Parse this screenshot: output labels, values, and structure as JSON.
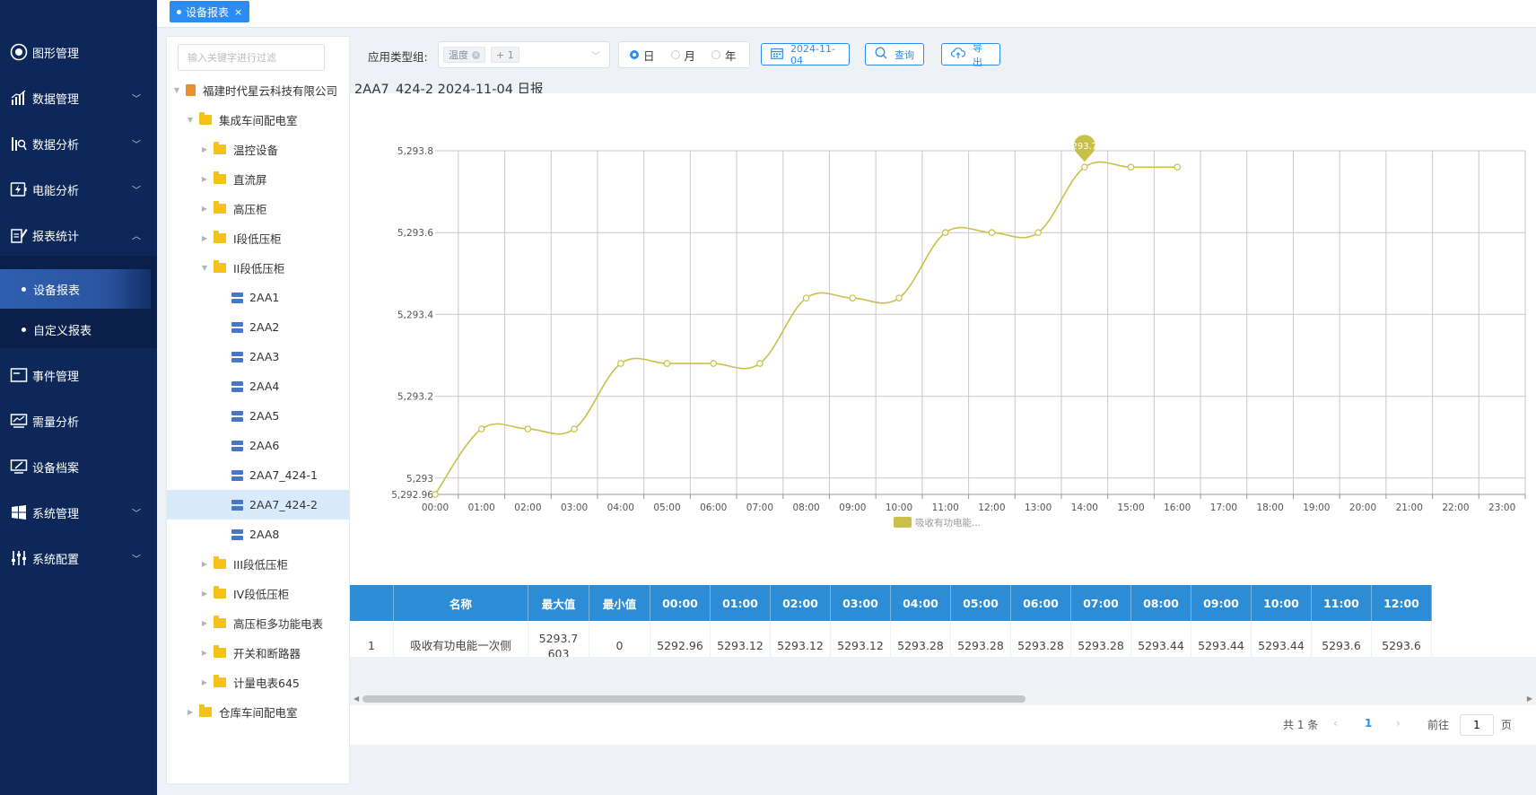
{
  "sidebar": {
    "items": [
      {
        "label": "图形管理",
        "icon": "shield-icon"
      },
      {
        "label": "数据管理",
        "icon": "bar-chart-icon"
      },
      {
        "label": "数据分析",
        "icon": "analysis-icon"
      },
      {
        "label": "电能分析",
        "icon": "lightning-icon"
      },
      {
        "label": "报表统计",
        "icon": "report-icon"
      },
      {
        "label": "事件管理",
        "icon": "event-icon"
      },
      {
        "label": "需量分析",
        "icon": "monitor-chart-icon"
      },
      {
        "label": "设备档案",
        "icon": "device-file-icon"
      },
      {
        "label": "系统管理",
        "icon": "windows-icon"
      },
      {
        "label": "系统配置",
        "icon": "sliders-icon"
      }
    ],
    "sub_items": [
      {
        "label": "设备报表"
      },
      {
        "label": "自定义报表"
      }
    ]
  },
  "tabs": [
    {
      "label": "设备报表",
      "close": "×"
    }
  ],
  "tree": {
    "filter_placeholder": "输入关键字进行过滤",
    "nodes": [
      {
        "label": "福建时代星云科技有限公司"
      },
      {
        "label": "集成车间配电室"
      },
      {
        "label": "温控设备"
      },
      {
        "label": "直流屏"
      },
      {
        "label": "高压柜"
      },
      {
        "label": "I段低压柜"
      },
      {
        "label": "II段低压柜"
      },
      {
        "label": "2AA1"
      },
      {
        "label": "2AA2"
      },
      {
        "label": "2AA3"
      },
      {
        "label": "2AA4"
      },
      {
        "label": "2AA5"
      },
      {
        "label": "2AA6"
      },
      {
        "label": "2AA7_424-1"
      },
      {
        "label": "2AA7_424-2"
      },
      {
        "label": "2AA8"
      },
      {
        "label": "III段低压柜"
      },
      {
        "label": "IV段低压柜"
      },
      {
        "label": "高压柜多功能电表"
      },
      {
        "label": "开关和断路器"
      },
      {
        "label": "计量电表645"
      },
      {
        "label": "仓库车间配电室"
      }
    ]
  },
  "toolbar": {
    "type_label": "应用类型组:",
    "tag_value": "温度",
    "tag_close": "×",
    "tag_more": "+ 1",
    "periods": [
      "日",
      "月",
      "年"
    ],
    "selected_period": "日",
    "date": "2024-11-04",
    "query_label": "查询",
    "export_label": "导出"
  },
  "report_title": "2AA7_424-2 2024-11-04 日报",
  "chart_data": {
    "type": "line",
    "title": "",
    "x": [
      "00:00",
      "01:00",
      "02:00",
      "03:00",
      "04:00",
      "05:00",
      "06:00",
      "07:00",
      "08:00",
      "09:00",
      "10:00",
      "11:00",
      "12:00",
      "13:00",
      "14:00",
      "15:00",
      "16:00",
      "17:00",
      "18:00",
      "19:00",
      "20:00",
      "21:00",
      "22:00",
      "23:00"
    ],
    "series": [
      {
        "name": "吸收有功电能...",
        "color": "#c9c04a",
        "values": [
          5292.96,
          5293.12,
          5293.12,
          5293.12,
          5293.28,
          5293.28,
          5293.28,
          5293.28,
          5293.44,
          5293.44,
          5293.44,
          5293.6,
          5293.6,
          5293.6,
          5293.76,
          5293.76,
          5293.76
        ]
      }
    ],
    "y_ticks": [
      "5,292.96",
      "5,293",
      "5,293.2",
      "5,293.4",
      "5,293.6",
      "5,293.8"
    ],
    "ylim": [
      5292.96,
      5293.8
    ],
    "max_marker": "5293.76",
    "grid": true,
    "smooth": true
  },
  "table": {
    "columns": [
      "",
      "名称",
      "最大值",
      "最小值",
      "00:00",
      "01:00",
      "02:00",
      "03:00",
      "04:00",
      "05:00",
      "06:00",
      "07:00",
      "08:00",
      "09:00",
      "10:00",
      "11:00",
      "12:00"
    ],
    "rows": [
      [
        "1",
        "吸收有功电能一次侧",
        "5293.7603",
        "0",
        "5292.96",
        "5293.12",
        "5293.12",
        "5293.12",
        "5293.28",
        "5293.28",
        "5293.28",
        "5293.28",
        "5293.44",
        "5293.44",
        "5293.44",
        "5293.6",
        "5293.6"
      ]
    ]
  },
  "pagination": {
    "total": "共 1 条",
    "current": "1",
    "prev": "‹",
    "next": "›",
    "goto_label": "前往",
    "goto_value": "1",
    "page_unit": "页"
  }
}
